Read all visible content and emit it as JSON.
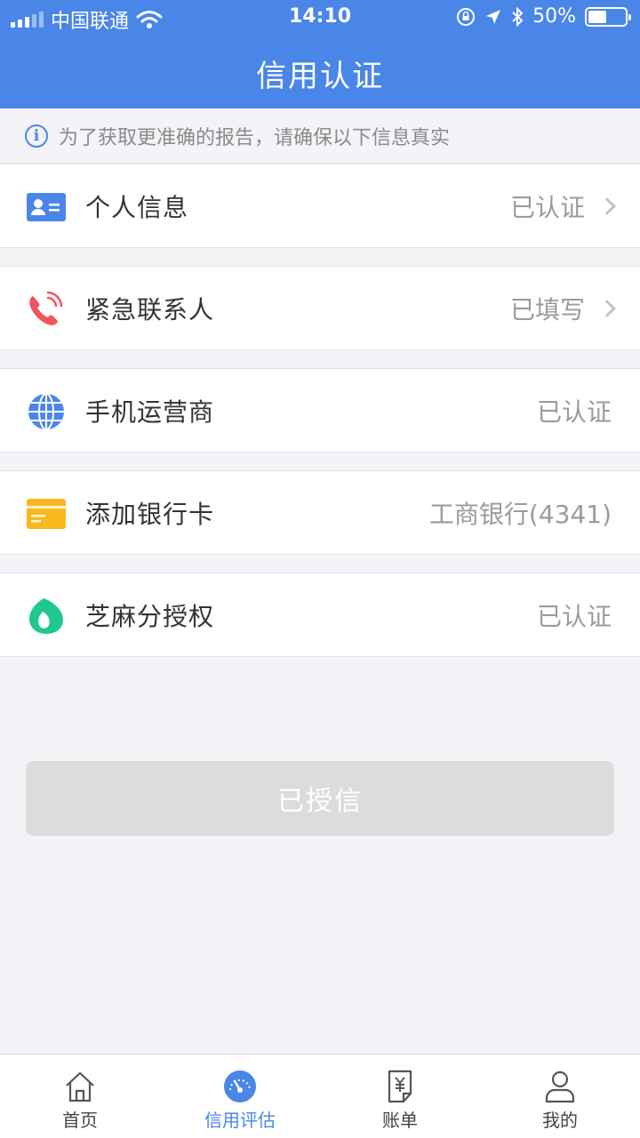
{
  "status_bar": {
    "carrier": "中国联通",
    "time": "14:10",
    "battery_percent": "50%",
    "battery_level": 0.5
  },
  "nav": {
    "title": "信用认证"
  },
  "notice": {
    "text": "为了获取更准确的报告，请确保以下信息真实"
  },
  "items": [
    {
      "label": "个人信息",
      "value": "已认证",
      "icon": "id-card-icon",
      "color": "#4a86e8"
    },
    {
      "label": "紧急联系人",
      "value": "已填写",
      "icon": "phone-icon",
      "color": "#f2545b"
    },
    {
      "label": "手机运营商",
      "value": "已认证",
      "icon": "globe-icon",
      "color": "#4a86e8"
    },
    {
      "label": "添加银行卡",
      "value": "工商银行(4341)",
      "icon": "bank-card-icon",
      "color": "#f9b81e"
    },
    {
      "label": "芝麻分授权",
      "value": "已认证",
      "icon": "sesame-icon",
      "color": "#1fc98e"
    }
  ],
  "main_button": {
    "label": "已授信"
  },
  "tabs": [
    {
      "label": "首页",
      "icon": "home-icon"
    },
    {
      "label": "信用评估",
      "icon": "gauge-icon",
      "active": true
    },
    {
      "label": "账单",
      "icon": "bill-icon"
    },
    {
      "label": "我的",
      "icon": "user-icon"
    }
  ],
  "colors": {
    "primary": "#4a86e8",
    "background": "#f4f3f8",
    "disabled_button": "#dcdcdc"
  }
}
